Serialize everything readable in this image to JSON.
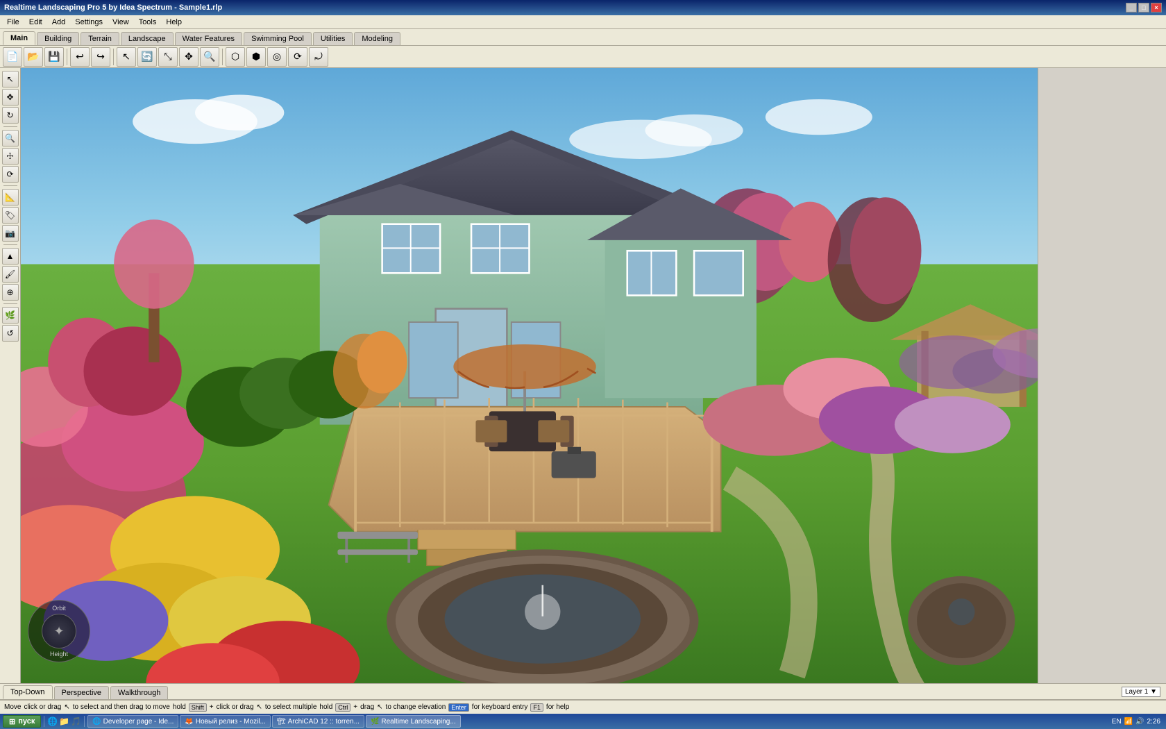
{
  "titlebar": {
    "title": "Realtime Landscaping Pro 5 by Idea Spectrum - Sample1.rlp",
    "controls": [
      "_",
      "□",
      "×"
    ]
  },
  "menubar": {
    "items": [
      "File",
      "Edit",
      "Add",
      "Settings",
      "View",
      "Tools",
      "Help"
    ]
  },
  "tabs": {
    "items": [
      "Main",
      "Building",
      "Terrain",
      "Landscape",
      "Water Features",
      "Swimming Pool",
      "Utilities",
      "Modeling"
    ],
    "active": "Main"
  },
  "toolbar": {
    "buttons": [
      "↩",
      "↪",
      "💾",
      "✂",
      "⊕",
      "⊗",
      "◎",
      "▣",
      "◈",
      "◉",
      "⟲",
      "⟳",
      "⤾"
    ]
  },
  "sidebar": {
    "buttons": [
      "↖",
      "✥",
      "⊙",
      "△",
      "▽",
      "◻",
      "⊞",
      "⊟",
      "⊠",
      "⊡",
      "●",
      "◎"
    ]
  },
  "view_tabs": {
    "items": [
      "Top-Down",
      "Perspective",
      "Walkthrough"
    ],
    "active": "Top-Down"
  },
  "layer": {
    "label": "Layer 1",
    "indicator": "▼"
  },
  "statusbar": {
    "move": "Move",
    "instruction": "click or drag",
    "pointer_icon": "↖",
    "to_select": "to select and then drag to move",
    "hold": "hold",
    "shift_key": "Shift",
    "plus1": "+",
    "click_or_drag2": "click or drag",
    "pointer_icon2": "↖",
    "to_select_multiple": "to select multiple",
    "hold2": "hold",
    "ctrl_key": "Ctrl",
    "plus2": "+",
    "drag3": "drag",
    "pointer_icon3": "↖",
    "to_change_elevation": "to change elevation",
    "enter_key": "Enter",
    "for_keyboard_entry": "for keyboard entry",
    "f1_key": "F1",
    "for_help": "for help"
  },
  "orbit_widget": {
    "label1": "Orbit",
    "label2": "Height"
  },
  "taskbar": {
    "start_label": "пуск",
    "items": [
      {
        "label": "Developer page - Ide...",
        "active": false
      },
      {
        "label": "Новый релиз - Mozil...",
        "active": false
      },
      {
        "label": "ArchiCAD 12 :: torren...",
        "active": false
      },
      {
        "label": "Realtime Landscaping...",
        "active": true
      }
    ],
    "tray": {
      "time": "2:26",
      "lang": "EN"
    }
  },
  "colors": {
    "sky_top": "#6bb8e8",
    "sky_bottom": "#c8e8f5",
    "grass": "#5a9e3a",
    "house_wall": "#8cb8a0",
    "roof": "#4a4a5a",
    "deck": "#c8a870",
    "accent": "#316ac5"
  }
}
